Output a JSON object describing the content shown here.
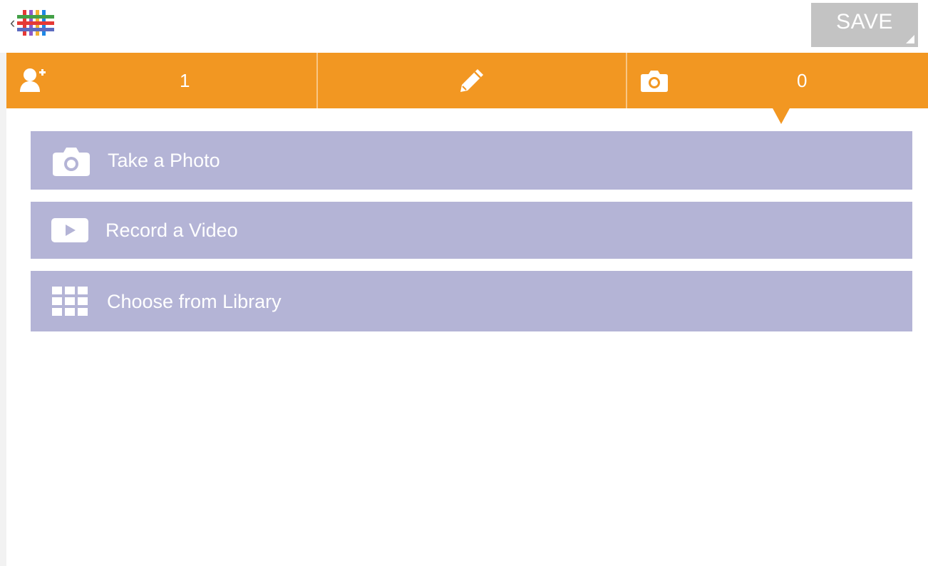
{
  "header": {
    "back_chevron": "‹",
    "logo_name": "app-logo",
    "save_label": "SAVE"
  },
  "tabs": [
    {
      "icon": "add-person-icon",
      "count": "1"
    },
    {
      "icon": "pencil-icon"
    },
    {
      "icon": "camera-icon",
      "count": "0",
      "active": true
    }
  ],
  "options": [
    {
      "label": "Take a Photo",
      "icon": "camera-icon"
    },
    {
      "label": "Record a Video",
      "icon": "video-play-icon"
    },
    {
      "label": "Choose from Library",
      "icon": "grid-library-icon"
    }
  ],
  "colors": {
    "accent": "#f29722",
    "option_bg": "#b4b4d6",
    "save_bg": "#c3c3c3"
  }
}
